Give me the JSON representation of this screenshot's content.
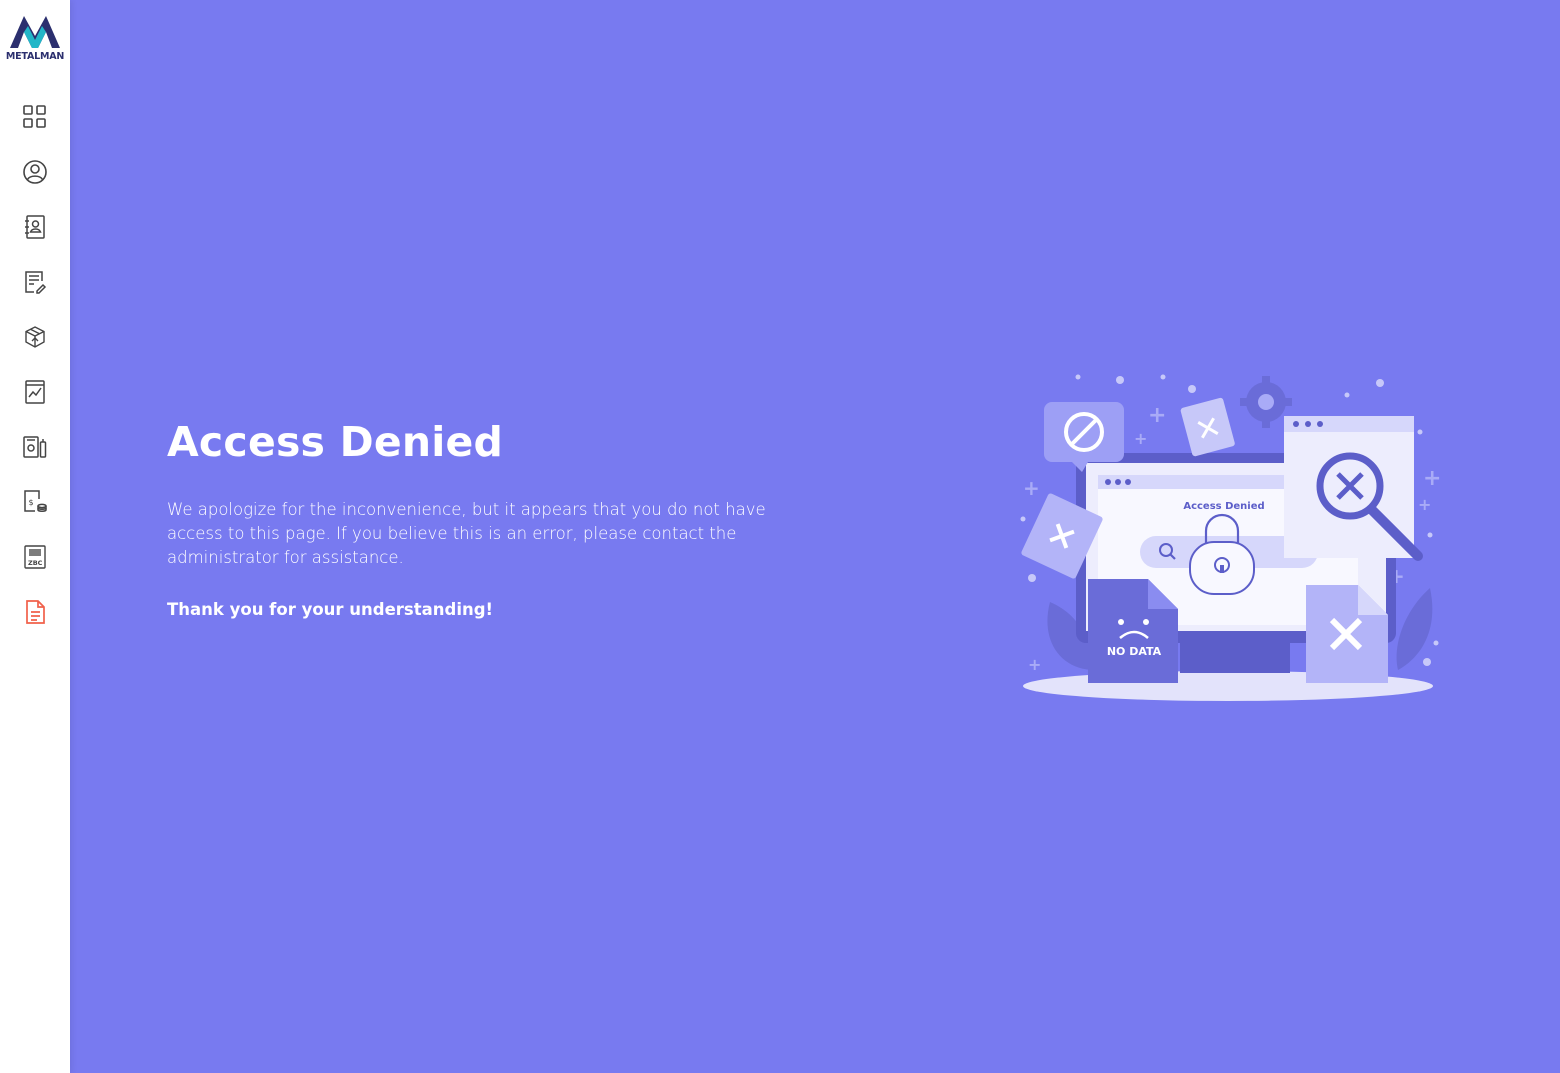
{
  "brand": {
    "name": "METALMAN"
  },
  "sidebar": {
    "items": [
      {
        "icon": "grid-icon"
      },
      {
        "icon": "user-circle-icon"
      },
      {
        "icon": "contact-book-icon"
      },
      {
        "icon": "document-edit-icon"
      },
      {
        "icon": "package-box-icon"
      },
      {
        "icon": "chart-report-icon"
      },
      {
        "icon": "devices-icon"
      },
      {
        "icon": "billing-icon"
      },
      {
        "icon": "barcode-icon"
      },
      {
        "icon": "document-active-icon"
      }
    ],
    "active_color": "#f1604a"
  },
  "main": {
    "background": "#787af0",
    "title": "Access Denied",
    "message": "We apologize for the inconvenience, but it appears that you do not have access to this page. If you believe this is an error, please contact the administrator for assistance.",
    "thanks": "Thank you for your understanding!"
  },
  "illustration": {
    "screen_label": "Access Denied",
    "file_label": "NO DATA"
  }
}
